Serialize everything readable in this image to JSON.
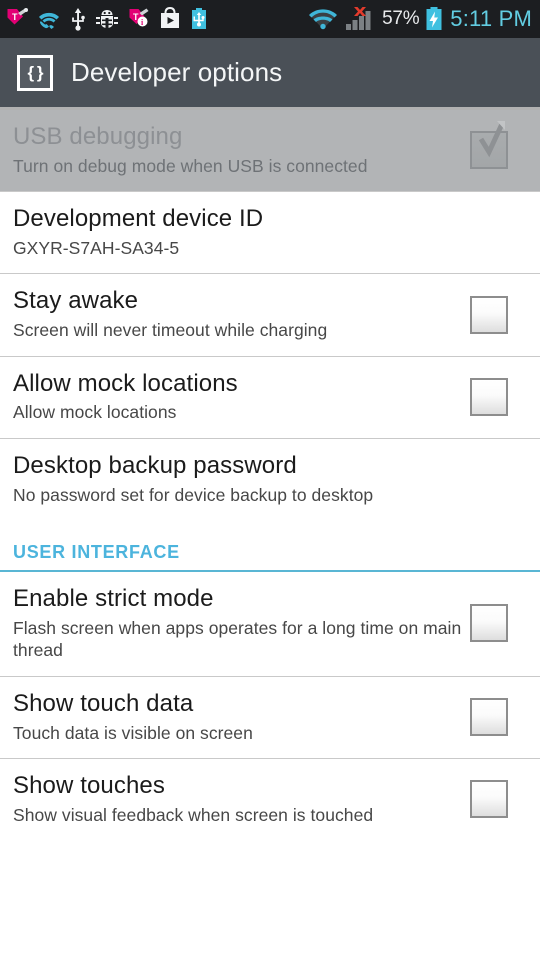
{
  "status_bar": {
    "left_icons": [
      {
        "name": "tmobile-tag-icon",
        "label": "T-Mobile"
      },
      {
        "name": "wifi-calling-icon",
        "label": "WiFi Calling"
      },
      {
        "name": "usb-icon",
        "label": "USB connected"
      },
      {
        "name": "android-debug-bug-icon",
        "label": "USB debugging"
      },
      {
        "name": "tmobile-info-tag-icon",
        "label": "T-Mobile notification"
      },
      {
        "name": "play-store-bag-icon",
        "label": "Play Store"
      },
      {
        "name": "usb-battery-icon",
        "label": "USB charging"
      }
    ],
    "right_icons": [
      {
        "name": "wifi-signal-icon",
        "label": "Wi-Fi connected"
      },
      {
        "name": "cell-signal-no-service-icon",
        "label": "No cellular service"
      },
      {
        "name": "battery-charging-icon",
        "label": "Charging"
      }
    ],
    "battery_percent": "57%",
    "clock": "5:11 PM"
  },
  "action_bar": {
    "icon": "curly-braces-icon",
    "icon_glyph": "{ }",
    "title": "Developer options"
  },
  "colors": {
    "accent_cyan": "#4cb4dd",
    "action_bar_bg": "#4a5057",
    "clock_cyan": "#62cde2",
    "pressed_row_bg": "#b2b4b6",
    "divider": "#c9c9c9"
  },
  "list": [
    {
      "kind": "checkbox_row",
      "name": "usb-debugging",
      "title": "USB debugging",
      "summary": "Turn on debug mode when USB is connected",
      "checked": true,
      "pressed": true
    },
    {
      "kind": "text_row",
      "name": "development-device-id",
      "title": "Development device ID",
      "summary": "GXYR-S7AH-SA34-5",
      "checked": null,
      "pressed": false
    },
    {
      "kind": "checkbox_row",
      "name": "stay-awake",
      "title": "Stay awake",
      "summary": "Screen will never timeout while charging",
      "checked": false,
      "pressed": false
    },
    {
      "kind": "checkbox_row",
      "name": "allow-mock-locations",
      "title": "Allow mock locations",
      "summary": "Allow mock locations",
      "checked": false,
      "pressed": false
    },
    {
      "kind": "text_row",
      "name": "desktop-backup-password",
      "title": "Desktop backup password",
      "summary": "No password set for device backup to desktop",
      "checked": null,
      "pressed": false
    },
    {
      "kind": "section_header",
      "name": "section-user-interface",
      "title": "USER INTERFACE"
    },
    {
      "kind": "checkbox_row",
      "name": "enable-strict-mode",
      "title": "Enable strict mode",
      "summary": "Flash screen when apps operates for a long time on main thread",
      "checked": false,
      "pressed": false
    },
    {
      "kind": "checkbox_row",
      "name": "show-touch-data",
      "title": "Show touch data",
      "summary": "Touch data is visible on screen",
      "checked": false,
      "pressed": false
    },
    {
      "kind": "checkbox_row",
      "name": "show-touches",
      "title": "Show touches",
      "summary": "Show visual feedback when screen is touched",
      "checked": false,
      "pressed": false
    }
  ]
}
